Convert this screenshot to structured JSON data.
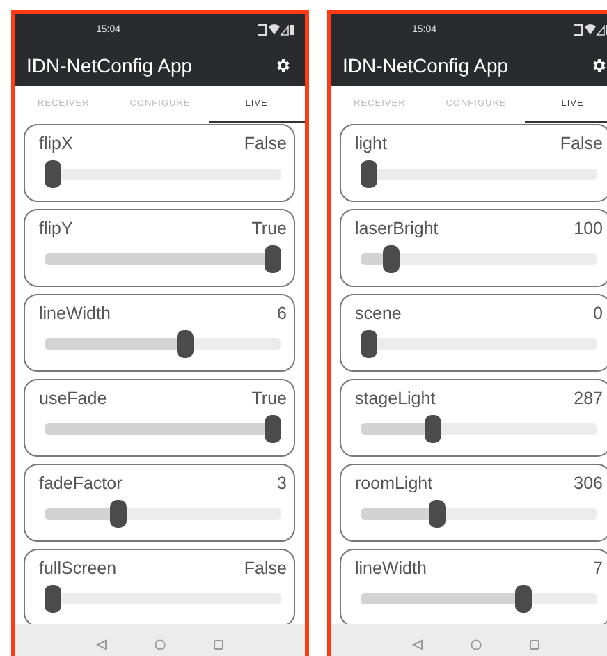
{
  "phones": [
    {
      "time": "15:04",
      "app_title": "IDN-NetConfig App",
      "tabs": [
        {
          "label": "RECEIVER",
          "selected": false
        },
        {
          "label": "CONFIGURE",
          "selected": false
        },
        {
          "label": "LIVE",
          "selected": true
        }
      ],
      "controls": [
        {
          "name": "flipX",
          "value": "False",
          "level": 0
        },
        {
          "name": "flipY",
          "value": "True",
          "level": 1
        },
        {
          "name": "lineWidth",
          "value": "6",
          "level": 0.6
        },
        {
          "name": "useFade",
          "value": "True",
          "level": 1
        },
        {
          "name": "fadeFactor",
          "value": "3",
          "level": 0.3
        },
        {
          "name": "fullScreen",
          "value": "False",
          "level": 0
        }
      ]
    },
    {
      "time": "15:04",
      "app_title": "IDN-NetConfig App",
      "tabs": [
        {
          "label": "RECEIVER",
          "selected": false
        },
        {
          "label": "CONFIGURE",
          "selected": false
        },
        {
          "label": "LIVE",
          "selected": true
        }
      ],
      "controls": [
        {
          "name": "light",
          "value": "False",
          "level": 0
        },
        {
          "name": "laserBright",
          "value": "100",
          "level": 0.1
        },
        {
          "name": "scene",
          "value": "0",
          "level": 0
        },
        {
          "name": "stageLight",
          "value": "287",
          "level": 0.29
        },
        {
          "name": "roomLight",
          "value": "306",
          "level": 0.31
        },
        {
          "name": "lineWidth",
          "value": "7",
          "level": 0.7
        }
      ]
    }
  ]
}
